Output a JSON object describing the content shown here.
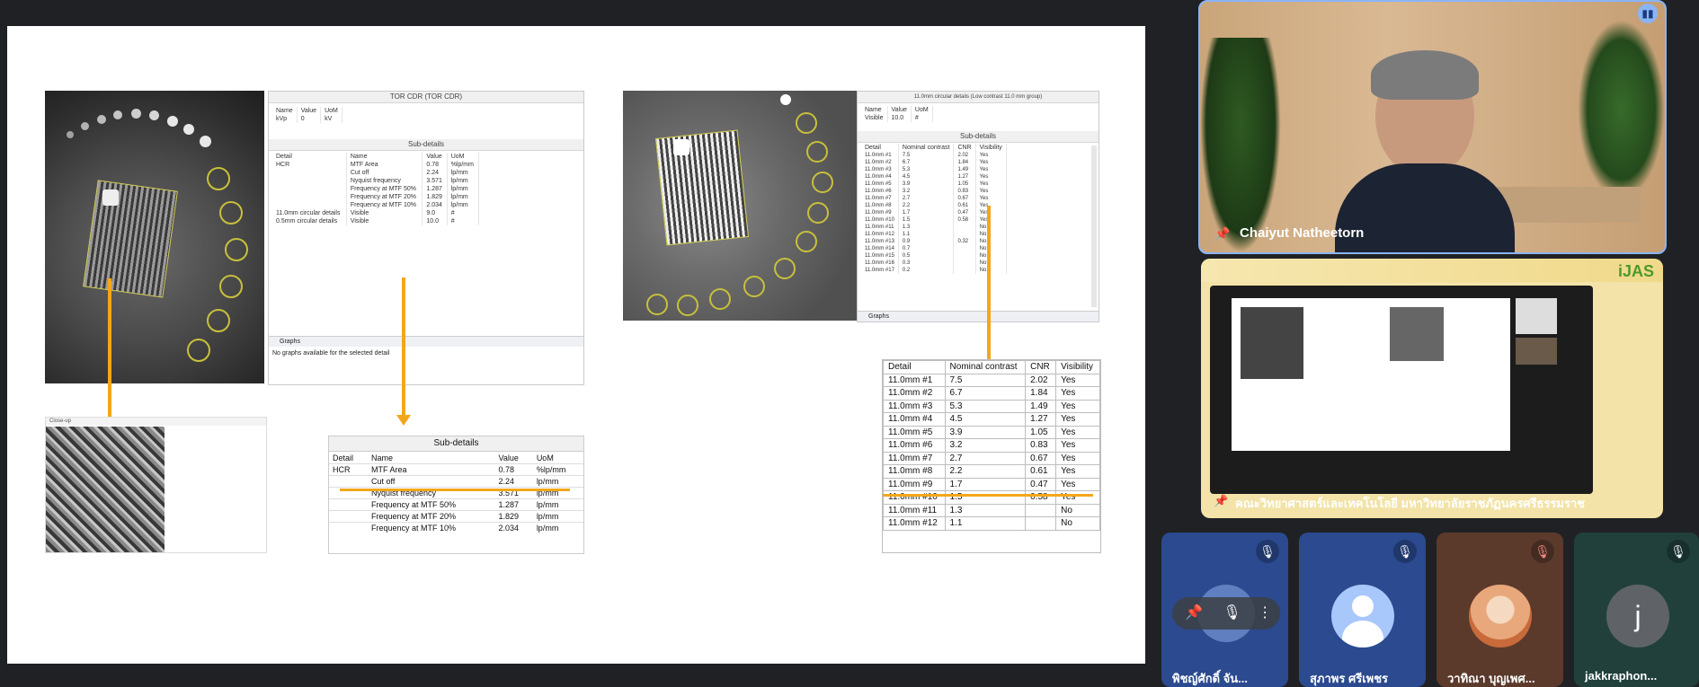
{
  "slide": {
    "left_panel": {
      "title": "TOR CDR (TOR CDR)",
      "params_header": [
        "Name",
        "Value",
        "UoM"
      ],
      "params_row": [
        "kVp",
        "0",
        "kV"
      ],
      "subdetails_title": "Sub-details",
      "columns": [
        "Detail",
        "Name",
        "Value",
        "UoM"
      ],
      "rows": [
        [
          "HCR",
          "MTF Area",
          "0.78",
          "%lp/mm"
        ],
        [
          "",
          "Cut off",
          "2.24",
          "lp/mm"
        ],
        [
          "",
          "Nyquist frequency",
          "3.571",
          "lp/mm"
        ],
        [
          "",
          "Frequency at MTF 50%",
          "1.287",
          "lp/mm"
        ],
        [
          "",
          "Frequency at MTF 20%",
          "1.829",
          "lp/mm"
        ],
        [
          "",
          "Frequency at MTF 10%",
          "2.034",
          "lp/mm"
        ],
        [
          "11.0mm circular details",
          "Visible",
          "9.0",
          "#"
        ],
        [
          "0.5mm circular details",
          "Visible",
          "10.0",
          "#"
        ]
      ],
      "graphs_tab": "Graphs",
      "graphs_empty": "No graphs available for the selected detail"
    },
    "closeup_title": "Close-up",
    "zoom_table": {
      "title": "Sub-details",
      "columns": [
        "Detail",
        "Name",
        "Value",
        "UoM"
      ],
      "rows": [
        [
          "HCR",
          "MTF Area",
          "0.78",
          "%lp/mm"
        ],
        [
          "",
          "Cut off",
          "2.24",
          "lp/mm"
        ],
        [
          "",
          "Nyquist frequency",
          "3.571",
          "lp/mm"
        ],
        [
          "",
          "Frequency at MTF 50%",
          "1.287",
          "lp/mm"
        ],
        [
          "",
          "Frequency at MTF 20%",
          "1.829",
          "lp/mm"
        ],
        [
          "",
          "Frequency at MTF 10%",
          "2.034",
          "lp/mm"
        ]
      ]
    },
    "right_panel": {
      "title": "11.0mm circular details (Low contrast 11.0 mm group)",
      "params_header": [
        "Name",
        "Value",
        "UoM"
      ],
      "params_row": [
        "Visible",
        "10.0",
        "#"
      ],
      "subdetails_title": "Sub-details",
      "columns": [
        "Detail",
        "Nominal contrast",
        "CNR",
        "Visibility"
      ],
      "rows": [
        [
          "11.0mm #1",
          "7.5",
          "2.02",
          "Yes"
        ],
        [
          "11.0mm #2",
          "6.7",
          "1.84",
          "Yes"
        ],
        [
          "11.0mm #3",
          "5.3",
          "1.49",
          "Yes"
        ],
        [
          "11.0mm #4",
          "4.5",
          "1.27",
          "Yes"
        ],
        [
          "11.0mm #5",
          "3.9",
          "1.05",
          "Yes"
        ],
        [
          "11.0mm #6",
          "3.2",
          "0.83",
          "Yes"
        ],
        [
          "11.0mm #7",
          "2.7",
          "0.67",
          "Yes"
        ],
        [
          "11.0mm #8",
          "2.2",
          "0.61",
          "Yes"
        ],
        [
          "11.0mm #9",
          "1.7",
          "0.47",
          "Yes"
        ],
        [
          "11.0mm #10",
          "1.5",
          "0.58",
          "Yes"
        ],
        [
          "11.0mm #11",
          "1.3",
          "",
          "No"
        ],
        [
          "11.0mm #12",
          "1.1",
          "",
          "No"
        ],
        [
          "11.0mm #13",
          "0.9",
          "0.32",
          "No"
        ],
        [
          "11.0mm #14",
          "0.7",
          "",
          "No"
        ],
        [
          "11.0mm #15",
          "0.5",
          "",
          "No"
        ],
        [
          "11.0mm #16",
          "0.3",
          "",
          "No"
        ],
        [
          "11.0mm #17",
          "0.2",
          "",
          "No"
        ]
      ],
      "graphs_tab": "Graphs"
    },
    "big_table": {
      "columns": [
        "Detail",
        "Nominal contrast",
        "CNR",
        "Visibility"
      ],
      "rows": [
        [
          "11.0mm #1",
          "7.5",
          "2.02",
          "Yes"
        ],
        [
          "11.0mm #2",
          "6.7",
          "1.84",
          "Yes"
        ],
        [
          "11.0mm #3",
          "5.3",
          "1.49",
          "Yes"
        ],
        [
          "11.0mm #4",
          "4.5",
          "1.27",
          "Yes"
        ],
        [
          "11.0mm #5",
          "3.9",
          "1.05",
          "Yes"
        ],
        [
          "11.0mm #6",
          "3.2",
          "0.83",
          "Yes"
        ],
        [
          "11.0mm #7",
          "2.7",
          "0.67",
          "Yes"
        ],
        [
          "11.0mm #8",
          "2.2",
          "0.61",
          "Yes"
        ],
        [
          "11.0mm #9",
          "1.7",
          "0.47",
          "Yes"
        ],
        [
          "11.0mm #10",
          "1.5",
          "0.58",
          "Yes"
        ],
        [
          "11.0mm #11",
          "1.3",
          "",
          "No"
        ],
        [
          "11.0mm #12",
          "1.1",
          "",
          "No"
        ]
      ]
    }
  },
  "participants": {
    "speaker": {
      "name": "Chaiyut Natheetorn"
    },
    "presenter": {
      "name": "คณะวิทยาศาสตร์และเทคโนโลยี มหาวิทยาลัยราชภัฏนครศรีธรรมราช",
      "banner": "iJAS"
    },
    "tiles": [
      {
        "name": "พิชญ์ศักดิ์ จัน...",
        "initial": ""
      },
      {
        "name": "สุภาพร ศรีเพชร",
        "initial": ""
      },
      {
        "name": "วาทิณา บุญเพศ...",
        "initial": ""
      },
      {
        "name": "jakkraphon...",
        "initial": "j"
      }
    ]
  },
  "colors": {
    "accent": "#f2a71b",
    "tile_blue": "#2b4a8f",
    "tile_brown": "#5b3a2c",
    "tile_teal": "#21403c"
  }
}
